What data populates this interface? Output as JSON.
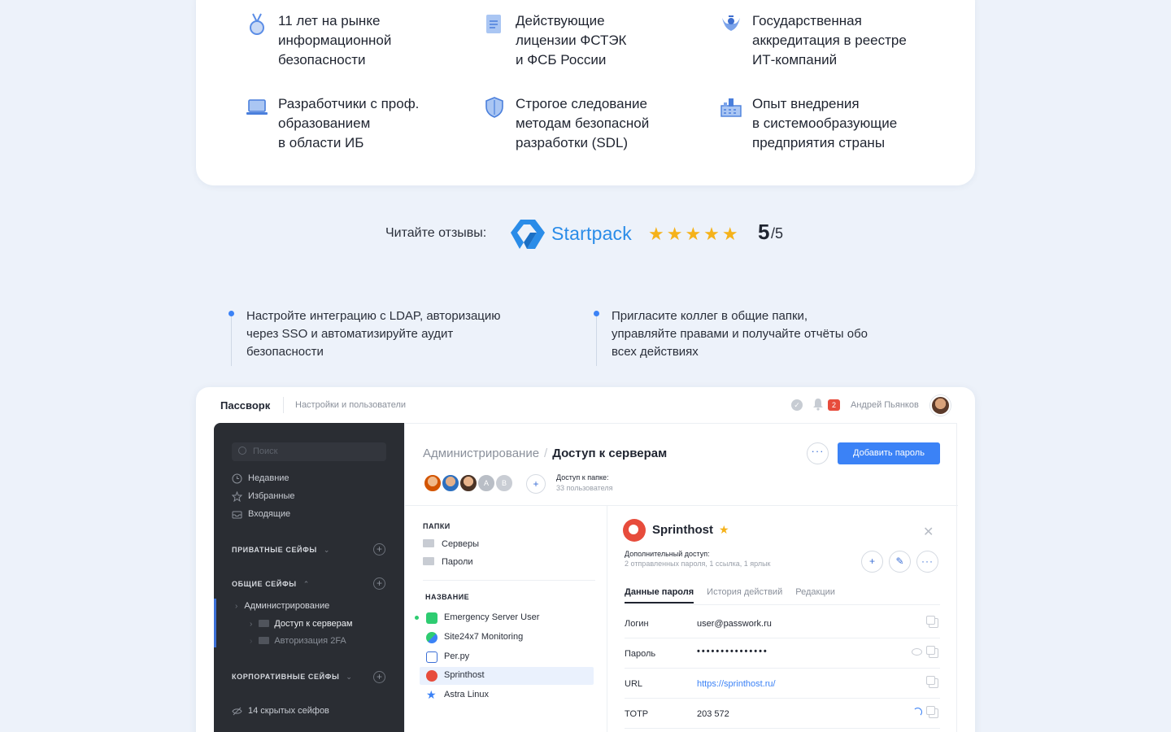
{
  "features": [
    {
      "icon": "medal-icon",
      "text": "11 лет на рынке\nинформационной\nбезопасности"
    },
    {
      "icon": "document-icon",
      "text": "Действующие\nлицензии ФСТЭК\nи ФСБ России"
    },
    {
      "icon": "eagle-emblem-icon",
      "text": "Государственная\nаккредитация в реестре\nИТ-компаний"
    },
    {
      "icon": "laptop-icon",
      "text": "Разработчики с проф.\nобразованием\nв области ИБ"
    },
    {
      "icon": "shield-icon",
      "text": "Строгое следование\nметодам безопасной\nразработки (SDL)"
    },
    {
      "icon": "factory-icon",
      "text": "Опыт внедрения\nв системообразующие\nпредприятия страны"
    }
  ],
  "reviews": {
    "label": "Читайте отзывы:",
    "platform": "Startpack",
    "stars": "★★★★★",
    "rating": 5,
    "score": "5",
    "of": "/5"
  },
  "bullets": [
    "Настройте интеграцию с LDAP, авторизацию\nчерез SSO и автоматизируйте аудит\nбезопасности",
    "Пригласите коллег в общие папки,\nуправляйте правами и получайте отчёты обо\nвсех действиях"
  ],
  "app": {
    "brand": "Пассворк",
    "crumb": "Настройки и пользователи",
    "notifications": "2",
    "user": "Андрей Пьянков",
    "sidebar": {
      "search_placeholder": "Поиск",
      "items": [
        "Недавние",
        "Избранные",
        "Входящие"
      ],
      "private": "ПРИВАТНЫЕ СЕЙФЫ",
      "shared": "ОБЩИЕ СЕЙФЫ",
      "tree": [
        "Администрирование",
        "Доступ к серверам",
        "Авторизация 2FA"
      ],
      "corporate": "КОРПОРАТИВНЫЕ СЕЙФЫ",
      "hidden": "14 скрытых сейфов"
    },
    "main": {
      "breadcrumb_parent": "Администрирование",
      "breadcrumb_current": "Доступ к серверам",
      "add_button": "Добавить пароль",
      "avatar_letters": [
        "A",
        "B"
      ],
      "access_label": "Доступ к папке:",
      "access_count": "33 пользователя",
      "folders_header": "ПАПКИ",
      "folders": [
        "Серверы",
        "Пароли"
      ],
      "names_header": "НАЗВАНИЕ",
      "entries": [
        "Emergency Server User",
        "Site24x7 Monitoring",
        "Per.py",
        "Sprinthost",
        "Astra Linux"
      ]
    },
    "detail": {
      "title": "Sprinthost",
      "extra_label": "Дополнительный доступ:",
      "extra_value": "2 отправленных пароля, 1 ссылка, 1 ярлык",
      "tabs": [
        "Данные пароля",
        "История действий",
        "Редакции"
      ],
      "fields": {
        "login_label": "Логин",
        "login": "user@passwork.ru",
        "password_label": "Пароль",
        "password": "•••••••••••••••",
        "url_label": "URL",
        "url": "https://sprinthost.ru/",
        "totp_label": "TOTP",
        "totp": "203 572"
      }
    }
  }
}
